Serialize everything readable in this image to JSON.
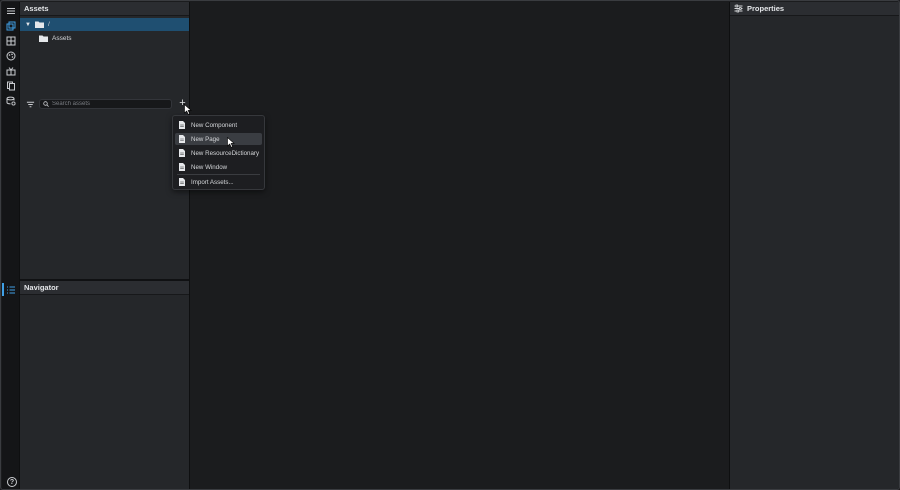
{
  "assets_panel": {
    "title": "Assets",
    "tree": [
      {
        "label": "/",
        "expanded": true,
        "selected": true
      },
      {
        "label": "Assets",
        "expanded": false,
        "selected": false
      }
    ],
    "search": {
      "placeholder": "Search assets",
      "value": ""
    },
    "add_label": "+"
  },
  "new_menu": {
    "items": [
      {
        "label": "New Component",
        "icon": "document-icon"
      },
      {
        "label": "New Page",
        "icon": "document-icon",
        "hovered": true
      },
      {
        "label": "New ResourceDictionary",
        "icon": "document-icon"
      },
      {
        "label": "New Window",
        "icon": "document-icon"
      },
      {
        "label": "Import Assets...",
        "icon": "document-icon"
      }
    ]
  },
  "navigator_panel": {
    "title": "Navigator"
  },
  "properties_panel": {
    "title": "Properties"
  },
  "activity_bar": {
    "items": [
      "menu-icon",
      "assets-icon",
      "components-icon",
      "palette-icon",
      "gift-icon",
      "pages-icon",
      "data-icon"
    ],
    "bottom": [
      "list-icon",
      "help-icon"
    ],
    "help_label": "?"
  },
  "colors": {
    "accent": "#3fa0e6",
    "selection": "#1f4f71",
    "panel": "#25272a",
    "canvas": "#1b1c1e"
  }
}
